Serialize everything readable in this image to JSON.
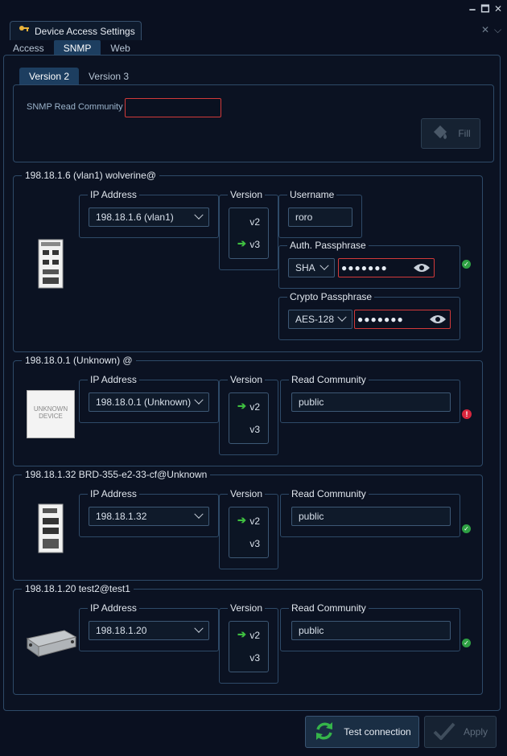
{
  "window": {
    "controls": [
      "🗕",
      "🗖",
      "✕"
    ]
  },
  "doc_tab": {
    "title": "Device Access Settings"
  },
  "tabs": [
    {
      "label": "Access",
      "active": false
    },
    {
      "label": "SNMP",
      "active": true
    },
    {
      "label": "Web",
      "active": false
    }
  ],
  "subtabs": [
    {
      "label": "Version 2",
      "active": true
    },
    {
      "label": "Version 3",
      "active": false
    }
  ],
  "v2": {
    "read_community_label": "SNMP Read Community",
    "read_community_value": "",
    "fill_label": "Fill"
  },
  "devices": [
    {
      "title": "198.18.1.6 (vlan1) wolverine@",
      "ip_label": "IP Address",
      "ip_value": "198.18.1.6 (vlan1)",
      "version_label": "Version",
      "selected_version": "v3",
      "username_label": "Username",
      "username_value": "roro",
      "auth_label": "Auth. Passphrase",
      "auth_algo": "SHA",
      "auth_masked": "●●●●●●●",
      "crypto_label": "Crypto Passphrase",
      "crypto_algo": "AES-128",
      "crypto_masked": "●●●●●●●",
      "status": "ok"
    },
    {
      "title": "198.18.0.1 (Unknown) @",
      "ip_label": "IP Address",
      "ip_value": "198.18.0.1 (Unknown)",
      "version_label": "Version",
      "selected_version": "v2",
      "community_label": "Read Community",
      "community_value": "public",
      "image_text_1": "UNKNOWN",
      "image_text_2": "DEVICE",
      "status": "error"
    },
    {
      "title": "198.18.1.32 BRD-355-e2-33-cf@Unknown",
      "ip_label": "IP Address",
      "ip_value": "198.18.1.32",
      "version_label": "Version",
      "selected_version": "v2",
      "community_label": "Read Community",
      "community_value": "public",
      "status": "ok"
    },
    {
      "title": "198.18.1.20 test2@test1",
      "ip_label": "IP Address",
      "ip_value": "198.18.1.20",
      "version_label": "Version",
      "selected_version": "v2",
      "community_label": "Read Community",
      "community_value": "public",
      "status": "ok"
    }
  ],
  "version_options": [
    "v2",
    "v3"
  ],
  "footer": {
    "test_label": "Test connection",
    "apply_label": "Apply"
  },
  "colors": {
    "accent": "#1d3e60",
    "ok": "#2ea043",
    "error": "#d7263d",
    "arrow": "#3fc040",
    "invalid_border": "#d23a3a"
  }
}
